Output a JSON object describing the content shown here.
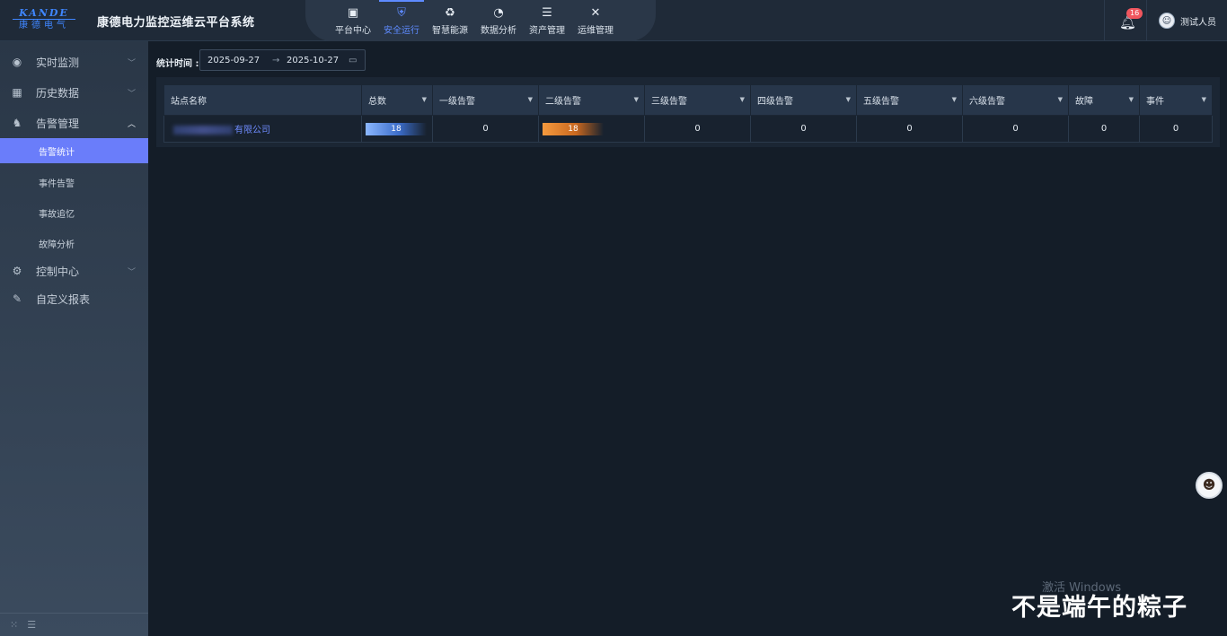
{
  "header": {
    "logo_en": "KANDE",
    "logo_cn": "康德电气",
    "title": "康德电力监控运维云平台系统",
    "nav": [
      {
        "label": "平台中心",
        "icon": "platform-icon"
      },
      {
        "label": "安全运行",
        "icon": "shield-icon",
        "active": true
      },
      {
        "label": "智慧能源",
        "icon": "recycle-icon"
      },
      {
        "label": "数据分析",
        "icon": "pie-chart-icon"
      },
      {
        "label": "资产管理",
        "icon": "database-icon"
      },
      {
        "label": "运维管理",
        "icon": "tools-icon"
      }
    ],
    "notification_count": "16",
    "user_name": "测试人员"
  },
  "sidebar": {
    "items": [
      {
        "label": "实时监测",
        "icon": "dashboard-icon"
      },
      {
        "label": "历史数据",
        "icon": "calendar-icon"
      },
      {
        "label": "告警管理",
        "icon": "alarm-icon",
        "expanded": true
      },
      {
        "label": "控制中心",
        "icon": "gear-icon"
      },
      {
        "label": "自定义报表",
        "icon": "edit-report-icon"
      }
    ],
    "sub_items": [
      {
        "label": "告警统计",
        "active": true
      },
      {
        "label": "事件告警"
      },
      {
        "label": "事故追忆"
      },
      {
        "label": "故障分析"
      }
    ]
  },
  "filter": {
    "label": "统计时间 :",
    "start_date": "2025-09-27",
    "separator": "→",
    "end_date": "2025-10-27"
  },
  "table": {
    "columns": [
      "站点名称",
      "总数",
      "一级告警",
      "二级告警",
      "三级告警",
      "四级告警",
      "五级告警",
      "六级告警",
      "故障",
      "事件"
    ],
    "rows": [
      {
        "station": "有限公司",
        "total": 18,
        "level1": "0",
        "level2": 18,
        "level3": "0",
        "level4": "0",
        "level5": "0",
        "level6": "0",
        "fault": "0",
        "event": "0"
      }
    ]
  },
  "watermark": "激活 Windows",
  "overlay_text": "不是端午的粽子",
  "colors": {
    "accent": "#6a7dfa",
    "nav_active": "#5e8bff",
    "badge": "#f0565e",
    "bar_blue": "#3b6cc8",
    "bar_orange": "#f59a3e"
  }
}
